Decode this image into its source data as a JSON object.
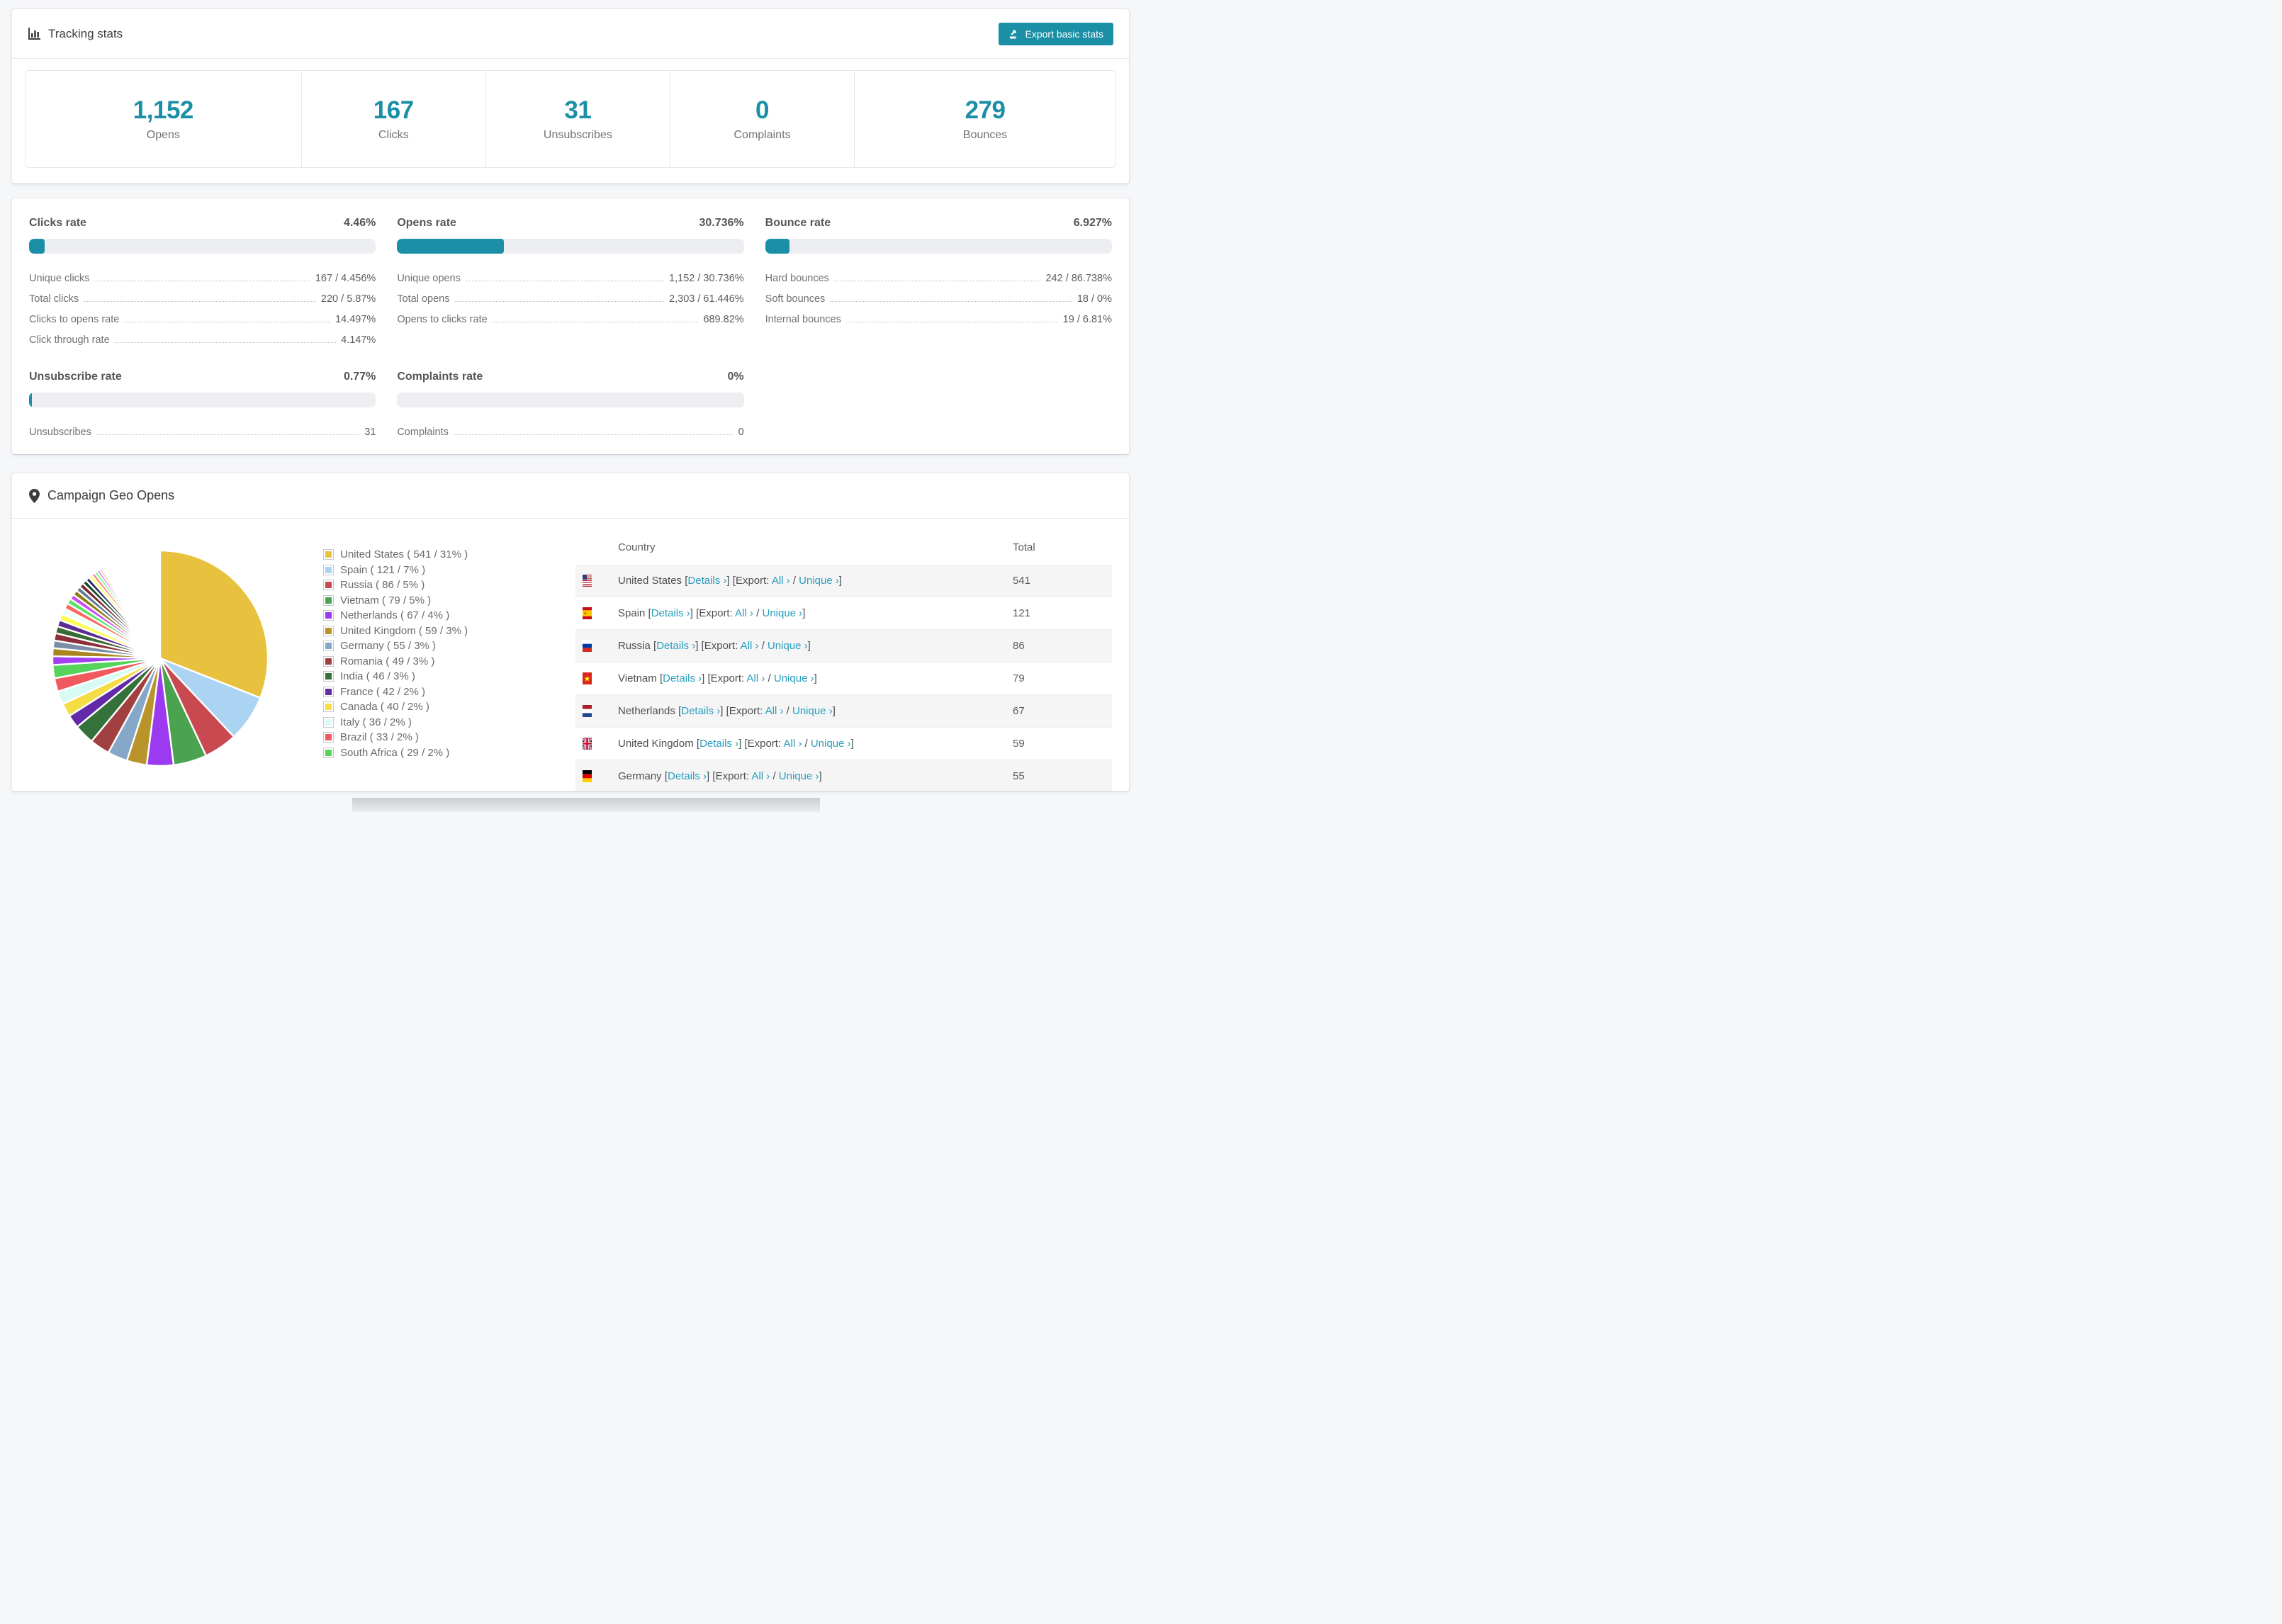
{
  "accent": "#1b8fa6",
  "tracking": {
    "title": "Tracking stats",
    "export_button": "Export basic stats",
    "stats": [
      {
        "value": "1,152",
        "label": "Opens"
      },
      {
        "value": "167",
        "label": "Clicks"
      },
      {
        "value": "31",
        "label": "Unsubscribes"
      },
      {
        "value": "0",
        "label": "Complaints"
      },
      {
        "value": "279",
        "label": "Bounces"
      }
    ]
  },
  "rates": {
    "sections": [
      {
        "title": "Clicks rate",
        "value": "4.46%",
        "percent": 4.46,
        "rows": [
          {
            "label": "Unique clicks",
            "value": "167 / 4.456%"
          },
          {
            "label": "Total clicks",
            "value": "220 / 5.87%"
          },
          {
            "label": "Clicks to opens rate",
            "value": "14.497%"
          },
          {
            "label": "Click through rate",
            "value": "4.147%"
          }
        ]
      },
      {
        "title": "Opens rate",
        "value": "30.736%",
        "percent": 30.736,
        "rows": [
          {
            "label": "Unique opens",
            "value": "1,152 / 30.736%"
          },
          {
            "label": "Total opens",
            "value": "2,303 / 61.446%"
          },
          {
            "label": "Opens to clicks rate",
            "value": "689.82%"
          }
        ]
      },
      {
        "title": "Bounce rate",
        "value": "6.927%",
        "percent": 6.927,
        "rows": [
          {
            "label": "Hard bounces",
            "value": "242 / 86.738%"
          },
          {
            "label": "Soft bounces",
            "value": "18 / 0%"
          },
          {
            "label": "Internal bounces",
            "value": "19 / 6.81%"
          }
        ]
      },
      {
        "title": "Unsubscribe rate",
        "value": "0.77%",
        "percent": 0.77,
        "rows": [
          {
            "label": "Unsubscribes",
            "value": "31"
          }
        ]
      },
      {
        "title": "Complaints rate",
        "value": "0%",
        "percent": 0,
        "rows": [
          {
            "label": "Complaints",
            "value": "0"
          }
        ]
      }
    ]
  },
  "geo": {
    "title": "Campaign Geo Opens",
    "table": {
      "headers": {
        "country": "Country",
        "total": "Total"
      },
      "labels": {
        "details": "Details ›",
        "export": "Export:",
        "all": "All ›",
        "unique": "Unique ›"
      },
      "rows": [
        {
          "country": "United States",
          "flag": "us",
          "total": "541"
        },
        {
          "country": "Spain",
          "flag": "es",
          "total": "121"
        },
        {
          "country": "Russia",
          "flag": "ru",
          "total": "86"
        },
        {
          "country": "Vietnam",
          "flag": "vn",
          "total": "79"
        },
        {
          "country": "Netherlands",
          "flag": "nl",
          "total": "67"
        },
        {
          "country": "United Kingdom",
          "flag": "gb",
          "total": "59"
        },
        {
          "country": "Germany",
          "flag": "de",
          "total": "55"
        }
      ]
    }
  },
  "chart_data": {
    "type": "pie",
    "title": "Campaign Geo Opens",
    "start_angle_deg": 0,
    "direction": "clockwise",
    "legend_position": "right",
    "series": [
      {
        "name": "United States",
        "count": 541,
        "pct": "31%",
        "value": 31,
        "color": "#e8c23e"
      },
      {
        "name": "Spain",
        "count": 121,
        "pct": "7%",
        "value": 7,
        "color": "#abd3f2"
      },
      {
        "name": "Russia",
        "count": 86,
        "pct": "5%",
        "value": 5,
        "color": "#c8494f"
      },
      {
        "name": "Vietnam",
        "count": 79,
        "pct": "5%",
        "value": 5,
        "color": "#4ba24f"
      },
      {
        "name": "Netherlands",
        "count": 67,
        "pct": "4%",
        "value": 4,
        "color": "#9b3af0"
      },
      {
        "name": "United Kingdom",
        "count": 59,
        "pct": "3%",
        "value": 3,
        "color": "#b8942b"
      },
      {
        "name": "Germany",
        "count": 55,
        "pct": "3%",
        "value": 3,
        "color": "#86a8c8"
      },
      {
        "name": "Romania",
        "count": 49,
        "pct": "3%",
        "value": 3,
        "color": "#a04040"
      },
      {
        "name": "India",
        "count": 46,
        "pct": "3%",
        "value": 3,
        "color": "#35713a"
      },
      {
        "name": "France",
        "count": 42,
        "pct": "2%",
        "value": 2,
        "color": "#6229a8"
      },
      {
        "name": "Canada",
        "count": 40,
        "pct": "2%",
        "value": 2,
        "color": "#f5dd45"
      },
      {
        "name": "Italy",
        "count": 36,
        "pct": "2%",
        "value": 2,
        "color": "#d8fbf6"
      },
      {
        "name": "Brazil",
        "count": 33,
        "pct": "2%",
        "value": 2,
        "color": "#f05a5e"
      },
      {
        "name": "South Africa",
        "count": 29,
        "pct": "2%",
        "value": 2,
        "color": "#55d45c"
      }
    ],
    "others_unlabeled": [
      {
        "value": 1.3,
        "color": "#a43ff0"
      },
      {
        "value": 1.2,
        "color": "#a8861d"
      },
      {
        "value": 1.15,
        "color": "#7a8fa5"
      },
      {
        "value": 1.1,
        "color": "#8b3039"
      },
      {
        "value": 1.05,
        "color": "#3a6b35"
      },
      {
        "value": 1.0,
        "color": "#5c2d91"
      },
      {
        "value": 0.95,
        "color": "#fdfd55"
      },
      {
        "value": 0.9,
        "color": "#effffa"
      },
      {
        "value": 0.85,
        "color": "#f96b62"
      },
      {
        "value": 0.8,
        "color": "#5be464"
      },
      {
        "value": 0.78,
        "color": "#cc4ef0"
      },
      {
        "value": 0.75,
        "color": "#8f7a12"
      },
      {
        "value": 0.72,
        "color": "#5f7c94"
      },
      {
        "value": 0.7,
        "color": "#7a2630"
      },
      {
        "value": 0.65,
        "color": "#1d4a2a"
      },
      {
        "value": 0.6,
        "color": "#2a2a6e"
      },
      {
        "value": 0.55,
        "color": "#ffff66"
      },
      {
        "value": 0.5,
        "color": "#ff7a70"
      },
      {
        "value": 0.45,
        "color": "#66ff70"
      },
      {
        "value": 0.4,
        "color": "#ee55ff"
      },
      {
        "value": 0.35,
        "color": "#d4a945"
      },
      {
        "value": 0.3,
        "color": "#a8cdf0"
      },
      {
        "value": 0.27,
        "color": "#e04848"
      },
      {
        "value": 0.24,
        "color": "#44aa44"
      },
      {
        "value": 0.2,
        "color": "#7733bb"
      },
      {
        "value": 0.17,
        "color": "#c09020"
      },
      {
        "value": 0.14,
        "color": "#88ccee"
      },
      {
        "value": 0.11,
        "color": "#cc3344"
      },
      {
        "value": 0.09,
        "color": "#33aa55"
      },
      {
        "value": 0.07,
        "color": "#9944dd"
      },
      {
        "value": 0.06,
        "color": "#ddaa33"
      },
      {
        "value": 0.05,
        "color": "#6688aa"
      },
      {
        "value": 0.04,
        "color": "#aa3366"
      },
      {
        "value": 0.03,
        "color": "#55bb99"
      }
    ]
  }
}
